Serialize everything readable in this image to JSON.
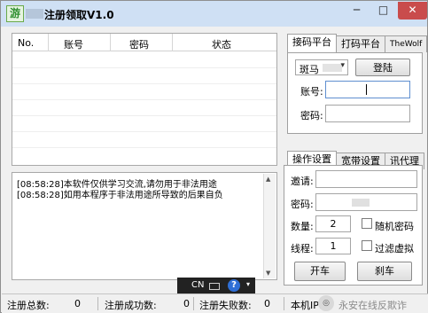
{
  "window": {
    "title": "注册领取V1.0",
    "icon_glyph": "游",
    "min_glyph": "─",
    "max_glyph": "□",
    "close_glyph": "✕"
  },
  "accounts_table": {
    "columns": [
      "No.",
      "账号",
      "密码",
      "状态"
    ],
    "rows": []
  },
  "log": {
    "lines": [
      "[08:58:28]本软件仅供学习交流,请勿用于非法用途",
      "[08:58:28]如用本程序于非法用途所导致的后果自负"
    ]
  },
  "ime_bar": {
    "lang": "CN",
    "help": "?"
  },
  "platform_tabs": {
    "tabs": [
      "接码平台",
      "打码平台",
      "TheWolf"
    ],
    "active": 0
  },
  "platform": {
    "provider_selected": "斑马",
    "login_label": "登陆",
    "account_label": "账号:",
    "account_value": "",
    "password_label": "密码:",
    "password_value": ""
  },
  "settings_tabs": {
    "tabs": [
      "操作设置",
      "宽带设置",
      "讯代理"
    ],
    "active": 0
  },
  "settings": {
    "invite_label": "邀请:",
    "invite_value": "",
    "password_label": "密码:",
    "count_label": "数量:",
    "count_value": "2",
    "random_password_label": "随机密码",
    "random_password_checked": false,
    "threads_label": "线程:",
    "threads_value": "1",
    "filter_virtual_label": "过滤虚拟",
    "filter_virtual_checked": false,
    "start_label": "开车",
    "stop_label": "刹车"
  },
  "status": {
    "total_label": "注册总数:",
    "total_value": "0",
    "success_label": "注册成功数:",
    "success_value": "0",
    "fail_label": "注册失败数:",
    "fail_value": "0",
    "ip_label": "本机IP:",
    "watermark": "永安在线反欺诈"
  }
}
